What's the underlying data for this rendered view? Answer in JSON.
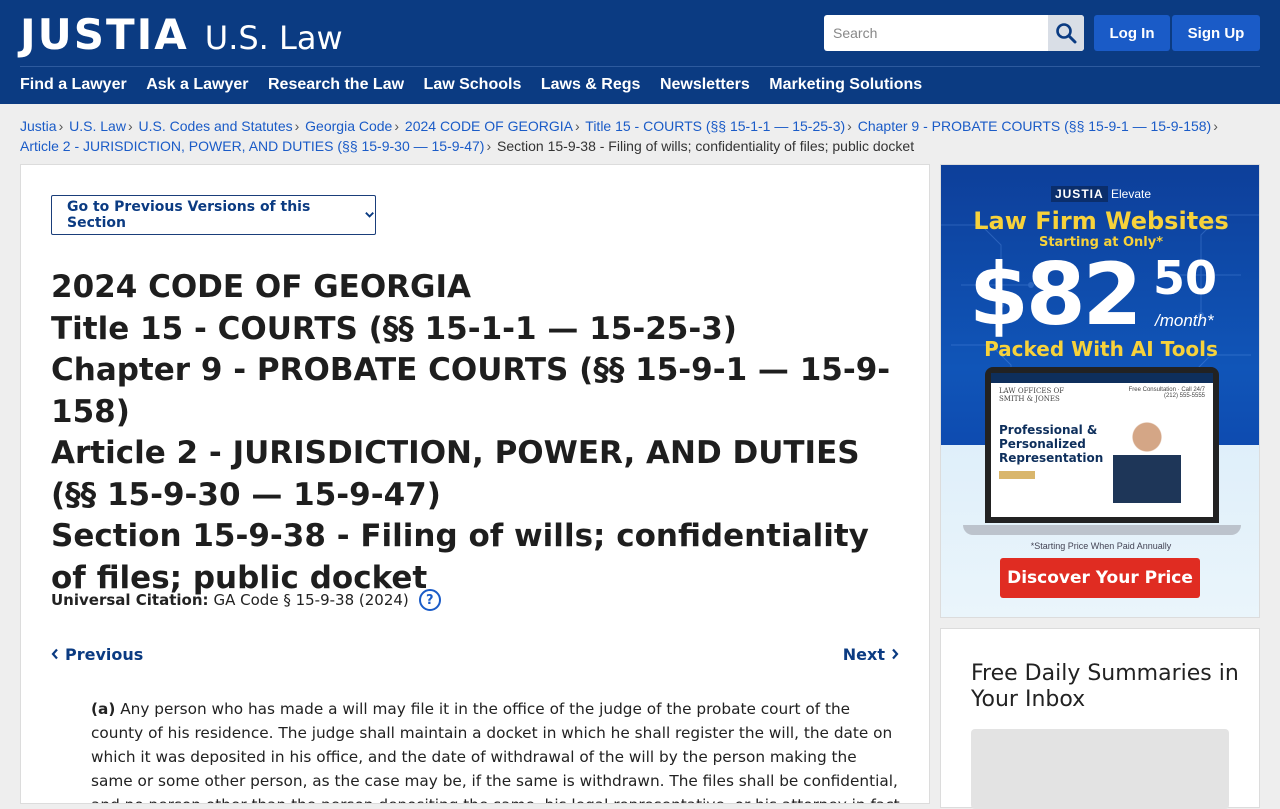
{
  "header": {
    "logo_main": "JUSTIA",
    "logo_sub": "U.S. Law",
    "search_placeholder": "Search",
    "login_label": "Log In",
    "signup_label": "Sign Up",
    "nav": [
      "Find a Lawyer",
      "Ask a Lawyer",
      "Research the Law",
      "Law Schools",
      "Laws & Regs",
      "Newsletters",
      "Marketing Solutions"
    ]
  },
  "breadcrumb": {
    "items": [
      "Justia",
      "U.S. Law",
      "U.S. Codes and Statutes",
      "Georgia Code",
      "2024 CODE OF GEORGIA",
      "Title 15 - COURTS (§§ 15-1-1 — 15-25-3)",
      "Chapter 9 - PROBATE COURTS (§§ 15-9-1 — 15-9-158)",
      "Article 2 - JURISDICTION, POWER, AND DUTIES (§§ 15-9-30 — 15-9-47)"
    ],
    "current": "Section 15-9-38 - Filing of wills; confidentiality of files; public docket"
  },
  "main": {
    "prev_versions_label": "Go to Previous Versions of this Section",
    "title_lines": [
      "2024 CODE OF GEORGIA",
      "Title 15 - COURTS (§§ 15-1-1 — 15-25-3)",
      "Chapter 9 - PROBATE COURTS (§§ 15-9-1 — 15-9-158)",
      "Article 2 - JURISDICTION, POWER, AND DUTIES (§§ 15-9-30 — 15-9-47)",
      "Section 15-9-38 - Filing of wills; confidentiality of files; public docket"
    ],
    "citation_label": "Universal Citation:",
    "citation_value": "GA Code § 15-9-38 (2024)",
    "help_glyph": "?",
    "previous_label": "Previous",
    "next_label": "Next",
    "para_marker": "(a)",
    "para_text": "Any person who has made a will may file it in the office of the judge of the probate court of the county of his residence. The judge shall maintain a docket in which he shall register the will, the date on which it was deposited in his office, and the date of withdrawal of the will by the person making the same or some other person, as the case may be, if the same is withdrawn. The files shall be confidential, and no person other than the person depositing the same, his legal representative, or his attorney in fact shall have access to the"
  },
  "ad": {
    "brand_main": "JUSTIA",
    "brand_sub": "Elevate",
    "headline": "Law Firm Websites",
    "starting": "Starting at Only*",
    "price": "$82",
    "cents": "50",
    "per_month": "/month*",
    "packed": "Packed With AI Tools",
    "screen_firm": "LAW OFFICES OF\nSMITH & JONES",
    "screen_phone": "Free Consultation · Call 24/7\n(212) 555-5555",
    "screen_copy": "Professional &\nPersonalized\nRepresentation",
    "fine_print": "*Starting Price When Paid Annually",
    "cta": "Discover Your Price"
  },
  "newsletter": {
    "title": "Free Daily Summaries in Your Inbox"
  },
  "colors": {
    "header_bg": "#0b3b82",
    "link": "#1a5bc7",
    "cta_red": "#e02c22",
    "ad_yellow": "#f7d23b"
  }
}
